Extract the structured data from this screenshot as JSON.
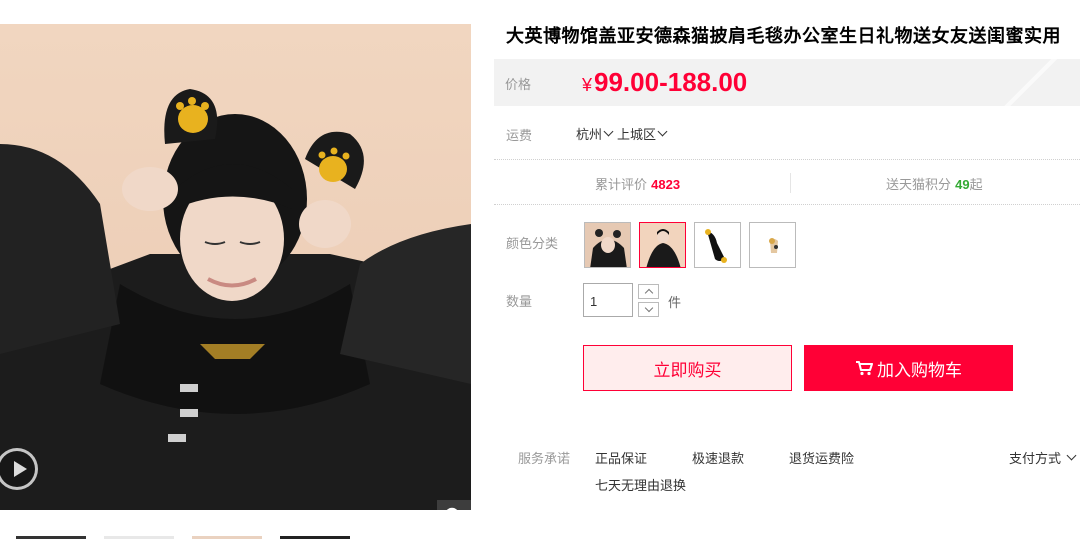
{
  "product": {
    "title": "大英博物馆盖亚安德森猫披肩毛毯办公室生日礼物送女友送闺蜜实用",
    "price_label": "价格",
    "currency_symbol": "¥",
    "price_range": "99.00-188.00",
    "shipping_label": "运费",
    "shipping_city": "杭州",
    "shipping_district": "上城区",
    "reviews_label": "累计评价",
    "reviews_count": "4823",
    "points_prefix": "送天猫积分",
    "points_value": "49",
    "points_suffix": "起",
    "color_label": "颜色分类",
    "quantity_label": "数量",
    "quantity_value": "1",
    "quantity_unit": "件"
  },
  "actions": {
    "buy_now": "立即购买",
    "add_to_cart": "加入购物车"
  },
  "services": {
    "label": "服务承诺",
    "items": [
      "正品保证",
      "极速退款",
      "退货运费险",
      "七天无理由退换"
    ],
    "payment": "支付方式"
  },
  "gallery": {
    "icons": [
      "play-icon",
      "zoom-icon"
    ]
  },
  "colors": {
    "accent": "#ff0036",
    "buy_bg": "#ffeded",
    "points_green": "#33aa33"
  }
}
